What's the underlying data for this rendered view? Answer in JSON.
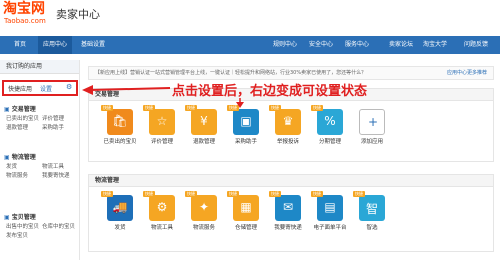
{
  "header": {
    "logo": "淘宝网",
    "logo_sub": "Taobao.com",
    "title": "卖家中心"
  },
  "nav": {
    "items": [
      "首页",
      "应用中心",
      "基础设置"
    ],
    "right_items": [
      "规则中心",
      "安全中心",
      "服务中心",
      "卖家论坛",
      "淘宝大学",
      "问题反馈"
    ]
  },
  "sidebar": {
    "title": "我订购的应用",
    "quick_label": "快捷应用",
    "quick_setting": "设置",
    "groups": [
      {
        "title": "交易管理",
        "links": [
          "已卖出的宝贝",
          "评价管理",
          "退款管理",
          "采购助手"
        ]
      },
      {
        "title": "物流管理",
        "links": [
          "发货",
          "物流工具",
          "物流服务",
          "我要寄快递"
        ]
      },
      {
        "title": "宝贝管理",
        "links": [
          "出售中的宝贝",
          "仓库中的宝贝",
          "发布宝贝"
        ]
      }
    ]
  },
  "notice": {
    "text": "【新应用上线】营销认证一站式营销管理平台上线，一键认证｜轻松提升和网络站，行业30%卖家已使用了，您还等什么？",
    "link": "应用中心更多推荐"
  },
  "panels": [
    {
      "title": "交易管理",
      "tiles": [
        {
          "label": "已卖出的宝贝",
          "color": "#f08a1c"
        },
        {
          "label": "评价管理",
          "color": "#f5a623"
        },
        {
          "label": "退款管理",
          "color": "#f5a623"
        },
        {
          "label": "采购助手",
          "color": "#1e88c7"
        },
        {
          "label": "举报投诉",
          "color": "#f5a623"
        },
        {
          "label": "分期管理",
          "color": "#2aa7d6"
        },
        {
          "label": "添加应用",
          "color": "#ffffff"
        }
      ]
    },
    {
      "title": "物流管理",
      "tiles": [
        {
          "label": "发货",
          "color": "#1e6fb8"
        },
        {
          "label": "物流工具",
          "color": "#f5a623"
        },
        {
          "label": "物流服务",
          "color": "#f5a623"
        },
        {
          "label": "仓储管理",
          "color": "#f5a623"
        },
        {
          "label": "我要寄快递",
          "color": "#1e88c7"
        },
        {
          "label": "电子面单平台",
          "color": "#1e88c7"
        },
        {
          "label": "智选",
          "color": "#2aa7d6"
        }
      ]
    }
  ],
  "tag": "快捷",
  "annotation": "点击设置后，右边变成可设置状态",
  "colors": {
    "accent": "#ff4400",
    "nav": "#2b6fb6",
    "highlight": "#e02020"
  }
}
